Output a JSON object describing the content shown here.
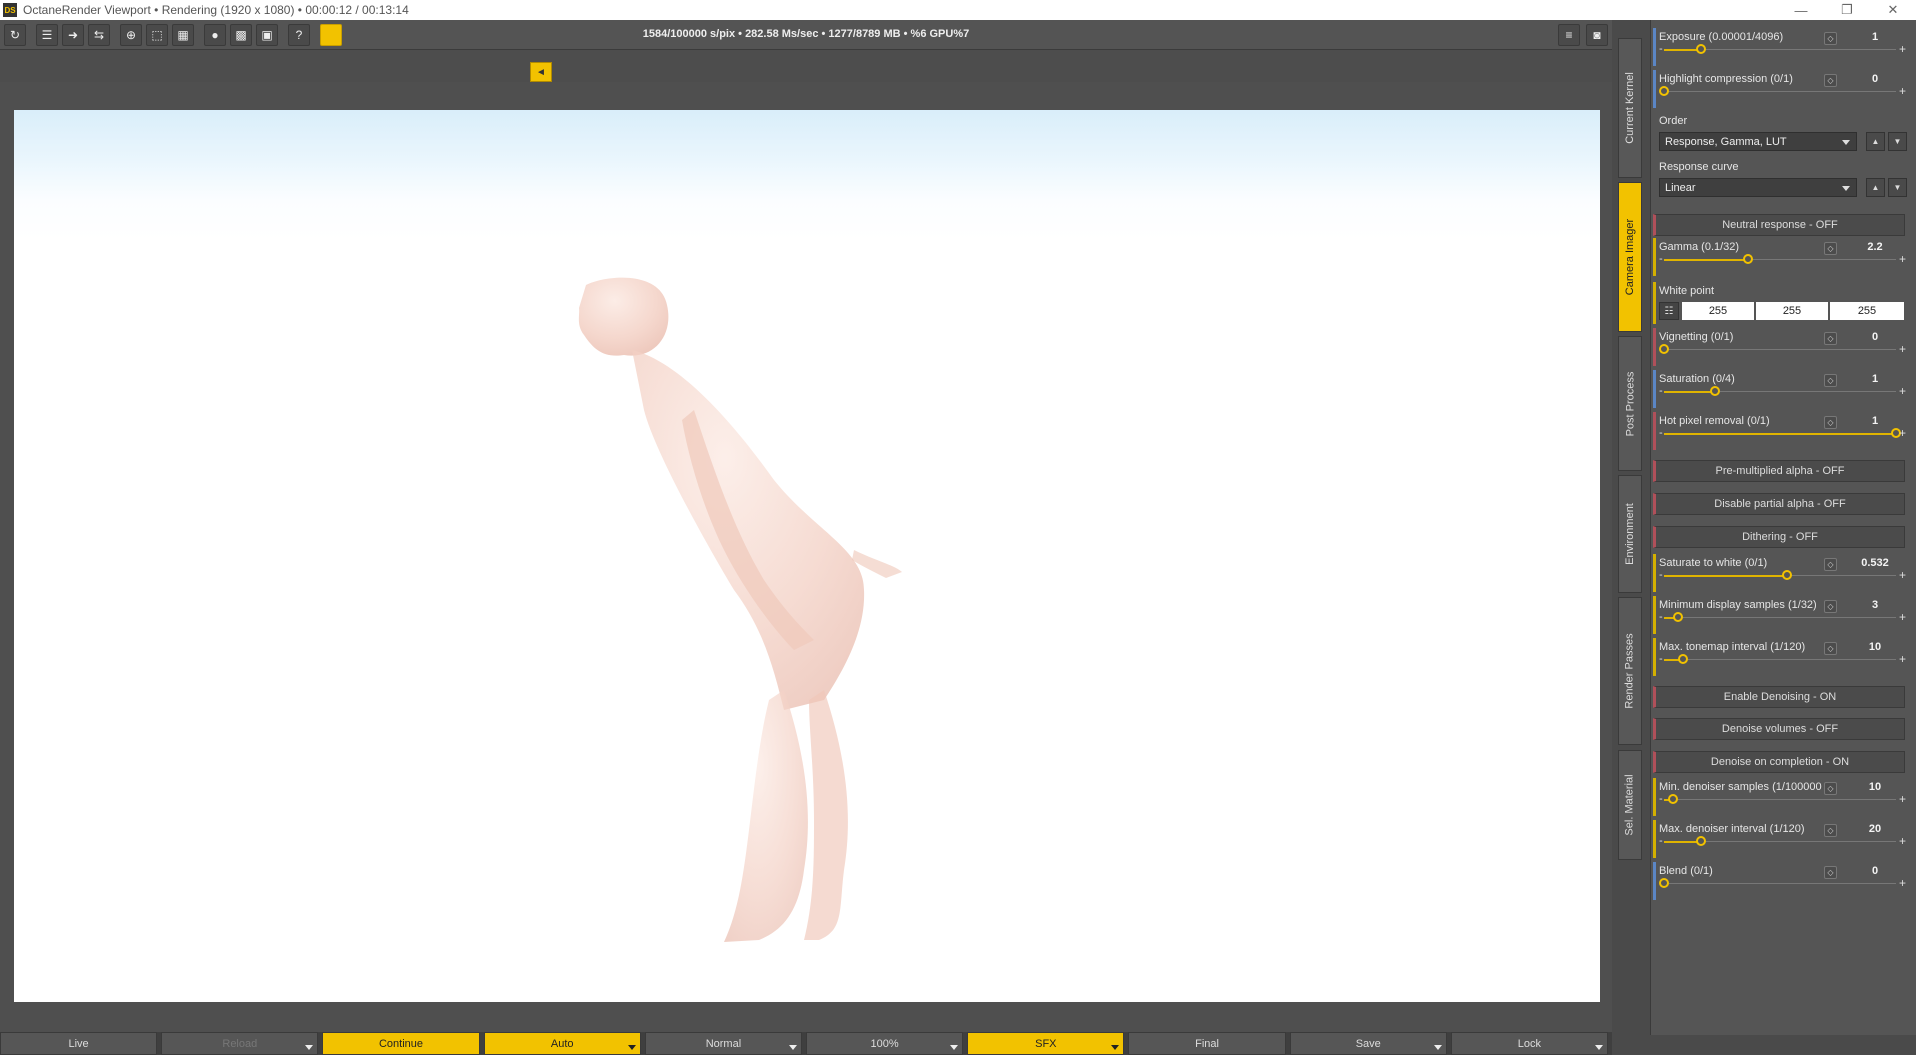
{
  "titlebar": {
    "app_logo": "DS",
    "title": "OctaneRender Viewport • Rendering (1920 x 1080) • 00:00:12 / 00:13:14",
    "minimize": "—",
    "restore": "❐",
    "close": "✕"
  },
  "toolbar": {
    "stats": "1584/100000 s/pix • 282.58 Ms/sec • 1277/8789 MB • %6 GPU%7",
    "buttons": [
      {
        "name": "restart-render-icon",
        "glyph": "↻"
      },
      {
        "name": "outline-icon",
        "glyph": "☰"
      },
      {
        "name": "export-icon",
        "glyph": "➜"
      },
      {
        "name": "share-icon",
        "glyph": "⇆"
      },
      {
        "name": "focus-picker-icon",
        "glyph": "⊕"
      },
      {
        "name": "region-icon",
        "glyph": "⬚"
      },
      {
        "name": "layout-icon",
        "glyph": "▦"
      },
      {
        "name": "record-icon",
        "glyph": "●"
      },
      {
        "name": "grid-icon",
        "glyph": "▩"
      },
      {
        "name": "image-icon",
        "glyph": "▣"
      },
      {
        "name": "help-icon",
        "glyph": "?"
      }
    ],
    "right_buttons": [
      {
        "name": "list-icon",
        "glyph": "≡"
      },
      {
        "name": "camera-icon",
        "glyph": "◙"
      }
    ],
    "collapse_glyph": "◄"
  },
  "bottom_bar": [
    {
      "label": "Live",
      "active": false,
      "dim": false,
      "dropdown": false
    },
    {
      "label": "Reload",
      "active": false,
      "dim": true,
      "dropdown": true
    },
    {
      "label": "Continue",
      "active": true,
      "dim": false,
      "dropdown": false
    },
    {
      "label": "Auto",
      "active": true,
      "dim": false,
      "dropdown": true
    },
    {
      "label": "Normal",
      "active": false,
      "dim": false,
      "dropdown": true
    },
    {
      "label": "100%",
      "active": false,
      "dim": false,
      "dropdown": true
    },
    {
      "label": "SFX",
      "active": true,
      "dim": false,
      "dropdown": true
    },
    {
      "label": "Final",
      "active": false,
      "dim": false,
      "dropdown": false
    },
    {
      "label": "Save",
      "active": false,
      "dim": false,
      "dropdown": true
    },
    {
      "label": "Lock",
      "active": false,
      "dim": false,
      "dropdown": true
    }
  ],
  "side_tabs": [
    {
      "label": "Current Kernel",
      "active": false
    },
    {
      "label": "Camera Imager",
      "active": true
    },
    {
      "label": "Post Process",
      "active": false
    },
    {
      "label": "Environment",
      "active": false
    },
    {
      "label": "Render Passes",
      "active": false
    },
    {
      "label": "Sel. Material",
      "active": false
    }
  ],
  "panel": {
    "exposure": {
      "label": "Exposure (0.00001/4096)",
      "value": "1",
      "fraction": 0.16
    },
    "highlight_compression": {
      "label": "Highlight compression (0/1)",
      "value": "0",
      "fraction": 0.0
    },
    "order": {
      "label": "Order",
      "value": "Response, Gamma, LUT"
    },
    "response_curve": {
      "label": "Response curve",
      "value": "Linear"
    },
    "neutral_response": "Neutral response - OFF",
    "gamma": {
      "label": "Gamma (0.1/32)",
      "value": "2.2",
      "fraction": 0.36
    },
    "white_point": {
      "label": "White point",
      "r": "255",
      "g": "255",
      "b": "255"
    },
    "vignetting": {
      "label": "Vignetting (0/1)",
      "value": "0",
      "fraction": 0.0
    },
    "saturation": {
      "label": "Saturation (0/4)",
      "value": "1",
      "fraction": 0.22
    },
    "hot_pixel_removal": {
      "label": "Hot pixel removal (0/1)",
      "value": "1",
      "fraction": 1.0
    },
    "premultiplied_alpha": "Pre-multiplied alpha - OFF",
    "disable_partial_alpha": "Disable partial alpha - OFF",
    "dithering": "Dithering - OFF",
    "saturate_to_white": {
      "label": "Saturate to white (0/1)",
      "value": "0.532",
      "fraction": 0.53
    },
    "min_display_samples": {
      "label": "Minimum display samples (1/32)",
      "value": "3",
      "fraction": 0.06
    },
    "max_tonemap_interval": {
      "label": "Max. tonemap interval (1/120)",
      "value": "10",
      "fraction": 0.08
    },
    "enable_denoising": "Enable Denoising - ON",
    "denoise_volumes": "Denoise volumes - OFF",
    "denoise_on_completion": "Denoise on completion - ON",
    "min_denoiser_samples": {
      "label": "Min. denoiser samples (1/100000",
      "value": "10",
      "fraction": 0.04
    },
    "max_denoiser_interval": {
      "label": "Max. denoiser interval (1/120)",
      "value": "20",
      "fraction": 0.16
    },
    "blend": {
      "label": "Blend (0/1)",
      "value": "0",
      "fraction": 0.0
    },
    "reset_glyph": "◇",
    "minus_glyph": "-",
    "plus_glyph": "+",
    "up_glyph": "▲",
    "down_glyph": "▼",
    "list_glyph": "☷"
  },
  "colors": {
    "accent": "#f2c200",
    "blue_stripe": "#5b86c5",
    "yellow_stripe": "#d4b000",
    "red_stripe": "#b0505a"
  }
}
